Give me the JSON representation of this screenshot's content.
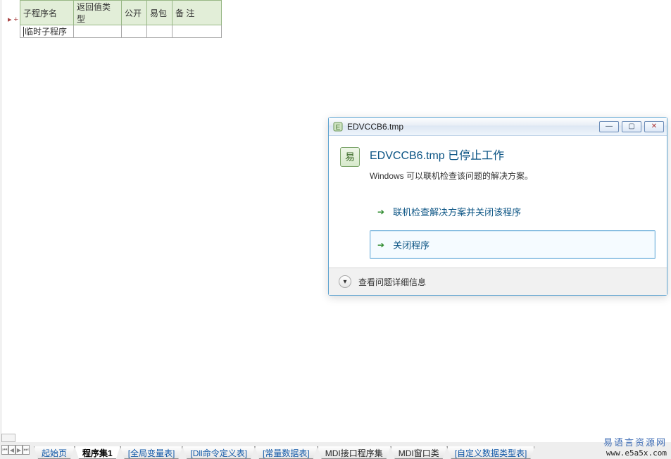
{
  "table": {
    "headers": [
      "子程序名",
      "返回值类型",
      "公开",
      "易包",
      "备 注"
    ],
    "row": {
      "name": "临时子程序",
      "retType": "",
      "public": "",
      "pkg": "",
      "remark": ""
    },
    "gutter_marker": "▸ +"
  },
  "dialog": {
    "windowTitle": "EDVCCB6.tmp",
    "title": "EDVCCB6.tmp 已停止工作",
    "subtitle": "Windows 可以联机检查该问题的解决方案。",
    "option1": "联机检查解决方案并关闭该程序",
    "option2": "关闭程序",
    "details": "查看问题详细信息",
    "iconGlyph": "易"
  },
  "tabs": {
    "items": [
      {
        "label": "起始页",
        "style": "link"
      },
      {
        "label": "程序集1",
        "style": "active"
      },
      {
        "label": "[全局变量表]",
        "style": "link"
      },
      {
        "label": "[Dll命令定义表]",
        "style": "link"
      },
      {
        "label": "[常量数据表]",
        "style": "link"
      },
      {
        "label": "MDI接口程序集",
        "style": "plain"
      },
      {
        "label": "MDI窗口类",
        "style": "plain"
      },
      {
        "label": "[自定义数据类型表]",
        "style": "link"
      }
    ]
  },
  "brand": {
    "cn": "易语言资源网",
    "url": "www.e5a5x.com"
  },
  "winctrl": {
    "min": "—",
    "max": "▢",
    "close": "✕"
  },
  "arrows": {
    "l2": "⏮",
    "l1": "◀",
    "r1": "▶",
    "r2": "⏭"
  }
}
